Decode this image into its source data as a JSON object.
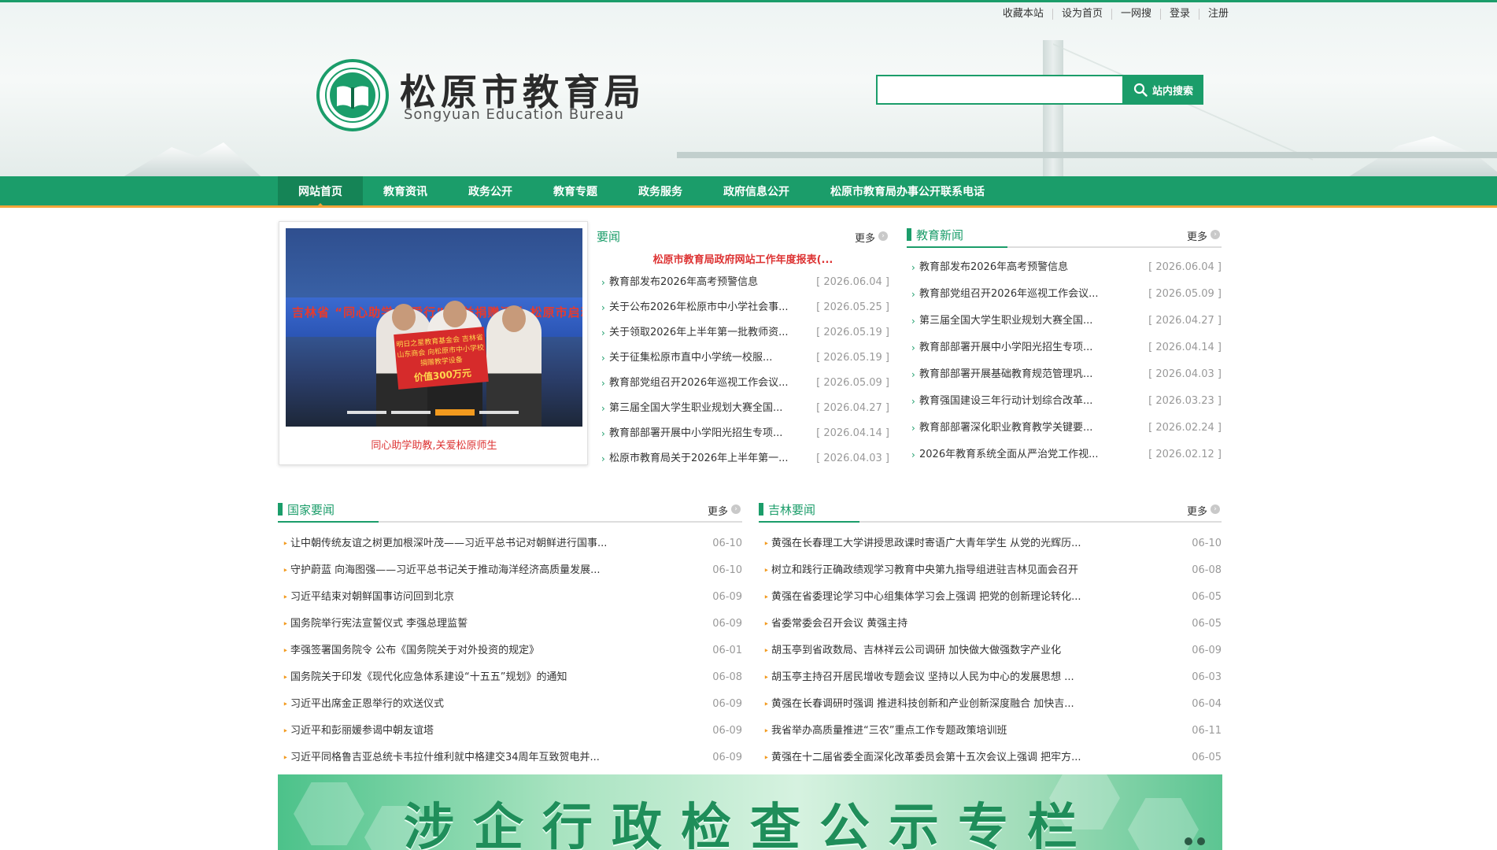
{
  "top_links": [
    "收藏本站",
    "设为首页",
    "一网搜",
    "登录",
    "注册"
  ],
  "site": {
    "title": "松原市教育局",
    "subtitle": "Songyuan Education Bureau"
  },
  "search": {
    "placeholder": "",
    "button_label": "站内搜索"
  },
  "nav": [
    "网站首页",
    "教育资讯",
    "政务公开",
    "教育专题",
    "政务服务",
    "政府信息公开",
    "松原市教育局办事公开联系电话"
  ],
  "slider": {
    "banner_text": "吉林省 “同心助学 关爱行” 公益捐赠活动 松原市启动仪式暨捐赠仪式",
    "board_text": "明日之星教育基金会 吉林省山东商会 向松原市中小学校捐赠教学设备",
    "board_amount": "价值300万元",
    "caption": "同心助学助教,关爱松原师生",
    "dots": 4,
    "active_dot": 2
  },
  "more_label": "更多",
  "yaowen": {
    "title": "要闻",
    "headline": "松原市教育局政府网站工作年度报表(...",
    "items": [
      {
        "text": "教育部发布2026年高考预警信息",
        "date": "[ 2026.06.04 ]"
      },
      {
        "text": "关于公布2026年松原市中小学社会事...",
        "date": "[ 2026.05.25 ]"
      },
      {
        "text": "关于领取2026年上半年第一批教师资...",
        "date": "[ 2026.05.19 ]"
      },
      {
        "text": "关于征集松原市直中小学统一校服...",
        "date": "[ 2026.05.19 ]"
      },
      {
        "text": "教育部党组召开2026年巡视工作会议...",
        "date": "[ 2026.05.09 ]"
      },
      {
        "text": "第三届全国大学生职业规划大赛全国...",
        "date": "[ 2026.04.27 ]"
      },
      {
        "text": "教育部部署开展中小学阳光招生专项...",
        "date": "[ 2026.04.14 ]"
      },
      {
        "text": "松原市教育局关于2026年上半年第一...",
        "date": "[ 2026.04.03 ]"
      }
    ]
  },
  "edu_news": {
    "title": "教育新闻",
    "items": [
      {
        "text": "教育部发布2026年高考预警信息",
        "date": "[ 2026.06.04 ]"
      },
      {
        "text": "教育部党组召开2026年巡视工作会议...",
        "date": "[ 2026.05.09 ]"
      },
      {
        "text": "第三届全国大学生职业规划大赛全国...",
        "date": "[ 2026.04.27 ]"
      },
      {
        "text": "教育部部署开展中小学阳光招生专项...",
        "date": "[ 2026.04.14 ]"
      },
      {
        "text": "教育部部署开展基础教育规范管理巩...",
        "date": "[ 2026.04.03 ]"
      },
      {
        "text": "教育强国建设三年行动计划综合改革...",
        "date": "[ 2026.03.23 ]"
      },
      {
        "text": "教育部部署深化职业教育教学关键要...",
        "date": "[ 2026.02.24 ]"
      },
      {
        "text": "2026年教育系统全面从严治党工作视...",
        "date": "[ 2026.02.12 ]"
      }
    ]
  },
  "national": {
    "title": "国家要闻",
    "items": [
      {
        "text": "让中朝传统友谊之树更加根深叶茂——习近平总书记对朝鲜进行国事...",
        "date": "06-10"
      },
      {
        "text": "守护蔚蓝 向海图强——习近平总书记关于推动海洋经济高质量发展...",
        "date": "06-10"
      },
      {
        "text": "习近平结束对朝鲜国事访问回到北京",
        "date": "06-09"
      },
      {
        "text": "国务院举行宪法宣誓仪式 李强总理监誓",
        "date": "06-09"
      },
      {
        "text": "李强签署国务院令 公布《国务院关于对外投资的规定》",
        "date": "06-01"
      },
      {
        "text": "国务院关于印发《现代化应急体系建设“十五五”规划》的通知",
        "date": "06-08"
      },
      {
        "text": "习近平出席金正恩举行的欢送仪式",
        "date": "06-09"
      },
      {
        "text": "习近平和彭丽媛参谒中朝友谊塔",
        "date": "06-09"
      },
      {
        "text": "习近平同格鲁吉亚总统卡韦拉什维利就中格建交34周年互致贺电并...",
        "date": "06-09"
      }
    ]
  },
  "jilin": {
    "title": "吉林要闻",
    "items": [
      {
        "text": "黄强在长春理工大学讲授思政课时寄语广大青年学生 从党的光辉历...",
        "date": "06-10"
      },
      {
        "text": "树立和践行正确政绩观学习教育中央第九指导组进驻吉林见面会召开",
        "date": "06-08"
      },
      {
        "text": "黄强在省委理论学习中心组集体学习会上强调 把党的创新理论转化...",
        "date": "06-05"
      },
      {
        "text": "省委常委会召开会议 黄强主持",
        "date": "06-05"
      },
      {
        "text": "胡玉亭到省政数局、吉林祥云公司调研 加快做大做强数字产业化",
        "date": "06-09"
      },
      {
        "text": "胡玉亭主持召开居民增收专题会议 坚持以人民为中心的发展思想 ...",
        "date": "06-03"
      },
      {
        "text": "黄强在长春调研时强调 推进科技创新和产业创新深度融合 加快吉...",
        "date": "06-04"
      },
      {
        "text": "我省举办高质量推进“三农”重点工作专题政策培训班",
        "date": "06-11"
      },
      {
        "text": "黄强在十二届省委全面深化改革委员会第十五次会议上强调 把牢方...",
        "date": "06-05"
      }
    ]
  },
  "promo_banner": {
    "text": "涉企行政检查公示专栏"
  },
  "colors": {
    "brand_green": "#1b9d6a",
    "accent_orange": "#f2a43a",
    "headline_red": "#dd3333"
  }
}
